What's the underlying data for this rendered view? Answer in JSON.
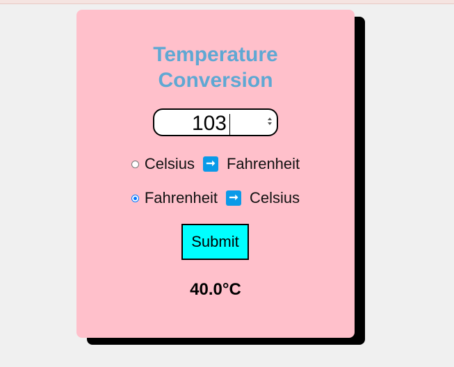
{
  "converter": {
    "title": "Temperature\nConversion",
    "input_value": "103",
    "options": [
      {
        "from": "Celsius",
        "to": "Fahrenheit",
        "checked": false
      },
      {
        "from": "Fahrenheit",
        "to": "Celsius",
        "checked": true
      }
    ],
    "arrow_icon": "right-arrow-icon",
    "submit_label": "Submit",
    "result": "40.0°C"
  },
  "colors": {
    "card_background": "#ffc0cb",
    "title": "#5fa8d3",
    "submit_background": "#00ffff",
    "arrow_icon": "#0a9ae8"
  }
}
